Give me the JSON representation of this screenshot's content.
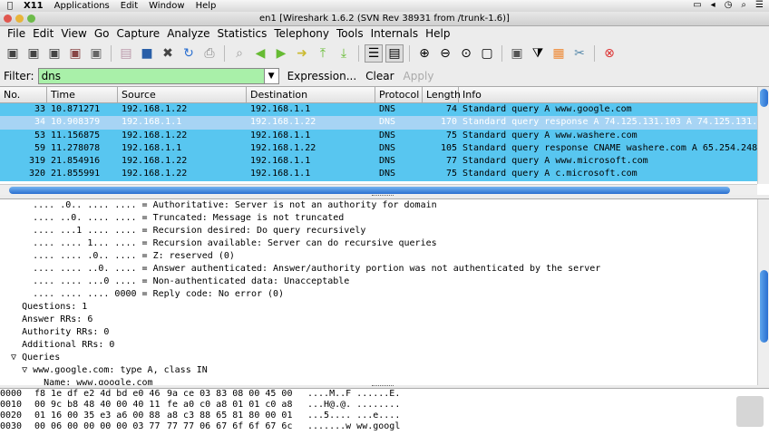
{
  "mac_menubar": {
    "app": "X11",
    "items": [
      "Applications",
      "Edit",
      "Window",
      "Help"
    ]
  },
  "window": {
    "title": "en1  [Wireshark 1.6.2  (SVN Rev 38931 from /trunk-1.6)]"
  },
  "menu": [
    "File",
    "Edit",
    "View",
    "Go",
    "Capture",
    "Analyze",
    "Statistics",
    "Telephony",
    "Tools",
    "Internals",
    "Help"
  ],
  "filter": {
    "label": "Filter:",
    "value": "dns",
    "expression": "Expression...",
    "clear": "Clear",
    "apply": "Apply",
    "color": "#a9f0a9"
  },
  "packet_list": {
    "columns": [
      "No.",
      "Time",
      "Source",
      "Destination",
      "Protocol",
      "Length",
      "Info"
    ],
    "rows": [
      [
        "33",
        "10.871271",
        "192.168.1.22",
        "192.168.1.1",
        "DNS",
        "74",
        "Standard query A www.google.com"
      ],
      [
        "34",
        "10.908379",
        "192.168.1.1",
        "192.168.1.22",
        "DNS",
        "170",
        "Standard query response A 74.125.131.103 A 74.125.131.1"
      ],
      [
        "53",
        "11.156875",
        "192.168.1.22",
        "192.168.1.1",
        "DNS",
        "75",
        "Standard query A www.washere.com"
      ],
      [
        "59",
        "11.278078",
        "192.168.1.1",
        "192.168.1.22",
        "DNS",
        "105",
        "Standard query response CNAME washere.com A 65.254.248."
      ],
      [
        "319",
        "21.854916",
        "192.168.1.22",
        "192.168.1.1",
        "DNS",
        "77",
        "Standard query A www.microsoft.com"
      ],
      [
        "320",
        "21.855991",
        "192.168.1.22",
        "192.168.1.1",
        "DNS",
        "75",
        "Standard query A c.microsoft.com"
      ]
    ],
    "selected_index": 1
  },
  "details": [
    "      .... .0.. .... .... = Authoritative: Server is not an authority for domain",
    "      .... ..0. .... .... = Truncated: Message is not truncated",
    "      .... ...1 .... .... = Recursion desired: Do query recursively",
    "      .... .... 1... .... = Recursion available: Server can do recursive queries",
    "      .... .... .0.. .... = Z: reserved (0)",
    "      .... .... ..0. .... = Answer authenticated: Answer/authority portion was not authenticated by the server",
    "      .... .... ...0 .... = Non-authenticated data: Unacceptable",
    "      .... .... .... 0000 = Reply code: No error (0)",
    "    Questions: 1",
    "    Answer RRs: 6",
    "    Authority RRs: 0",
    "    Additional RRs: 0",
    "  ▽ Queries",
    "    ▽ www.google.com: type A, class IN",
    "        Name: www.google.com"
  ],
  "hex": [
    {
      "offset": "0000",
      "h1": "f8 1e df e2 4d bd e0 46",
      "h2": "9a ce 03 83 08 00 45 00",
      "ascii": "....M..F ......E."
    },
    {
      "offset": "0010",
      "h1": "00 9c b8 48 40 00 40 11",
      "h2": "fe a0 c0 a8 01 01 c0 a8",
      "ascii": "...H@.@. ........"
    },
    {
      "offset": "0020",
      "h1": "01 16 00 35 e3 a6 00 88",
      "h2": "a8 c3 88 65 81 80 00 01",
      "ascii": "...5.... ...e...."
    },
    {
      "offset": "0030",
      "h1": "00 06 00 00 00 00 03 77",
      "h2": "77 77 06 67 6f 6f 67 6c",
      "ascii": ".......w ww.googl"
    }
  ]
}
